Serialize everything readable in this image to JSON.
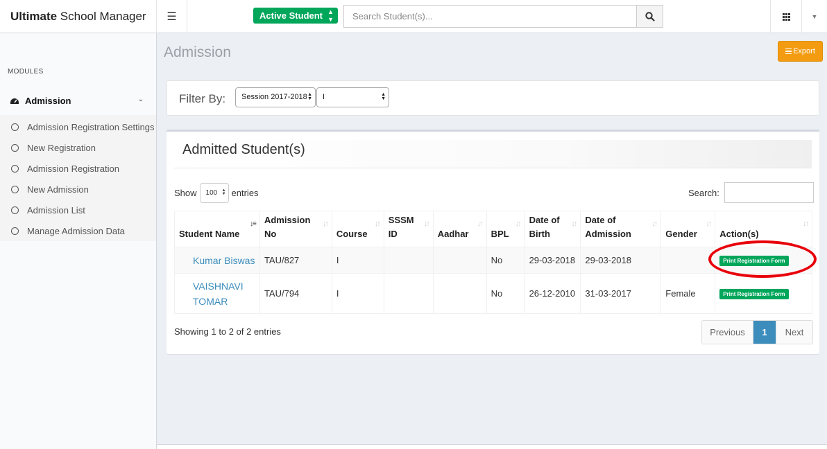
{
  "topbar": {
    "brand_bold": "Ultimate",
    "brand_rest": " School Manager",
    "status_filter": "Active Student",
    "search_placeholder": "Search Student(s)..."
  },
  "sidebar": {
    "modules_label": "MODULES",
    "parent": "Admission",
    "items": [
      {
        "label": "Admission Registration Settings"
      },
      {
        "label": "New Registration"
      },
      {
        "label": "Admission Registration"
      },
      {
        "label": "New Admission"
      },
      {
        "label": "Admission List"
      },
      {
        "label": "Manage Admission Data"
      }
    ]
  },
  "page": {
    "title": "Admission",
    "export_label": "Export"
  },
  "filter": {
    "label": "Filter By:",
    "session": "Session 2017-2018",
    "class": "I"
  },
  "table_box": {
    "title": "Admitted Student(s)",
    "show_label": "Show",
    "page_length": "100",
    "entries_label": "entries",
    "search_label": "Search:",
    "columns": {
      "name": "Student Name",
      "adm_no_1": "Admission",
      "adm_no_2": "No",
      "course": "Course",
      "sssm_1": "SSSM",
      "sssm_2": "ID",
      "aadhar": "Aadhar",
      "bpl": "BPL",
      "dob_1": "Date of",
      "dob_2": "Birth",
      "doa_1": "Date of",
      "doa_2": "Admission",
      "gender": "Gender",
      "action": "Action(s)"
    },
    "rows": [
      {
        "name": "Kumar Biswas",
        "name_line2": "",
        "adm_no": "TAU/827",
        "course": "I",
        "sssm_id": "",
        "aadhar": "",
        "bpl": "No",
        "dob": "29-03-2018",
        "doa": "29-03-2018",
        "gender": "",
        "action": "Print Registration Form"
      },
      {
        "name": "VAISHNAVI",
        "name_line2": "TOMAR",
        "adm_no": "TAU/794",
        "course": "I",
        "sssm_id": "",
        "aadhar": "",
        "bpl": "No",
        "dob": "26-12-2010",
        "doa": "31-03-2017",
        "gender": "Female",
        "action": "Print Registration Form"
      }
    ],
    "info": "Showing 1 to 2 of 2 entries",
    "pagination": {
      "previous": "Previous",
      "current": "1",
      "next": "Next"
    }
  },
  "colors": {
    "green": "#00a65a",
    "orange": "#f39c12",
    "link_blue": "#3c8dbc",
    "highlight_ring": "#e8000b"
  },
  "icons": [
    "menu-icon",
    "search-icon",
    "apps-grid-icon",
    "caret-down-icon",
    "dashboard-icon",
    "chevron-down-icon",
    "circle-icon",
    "list-icon",
    "sort-icon"
  ]
}
